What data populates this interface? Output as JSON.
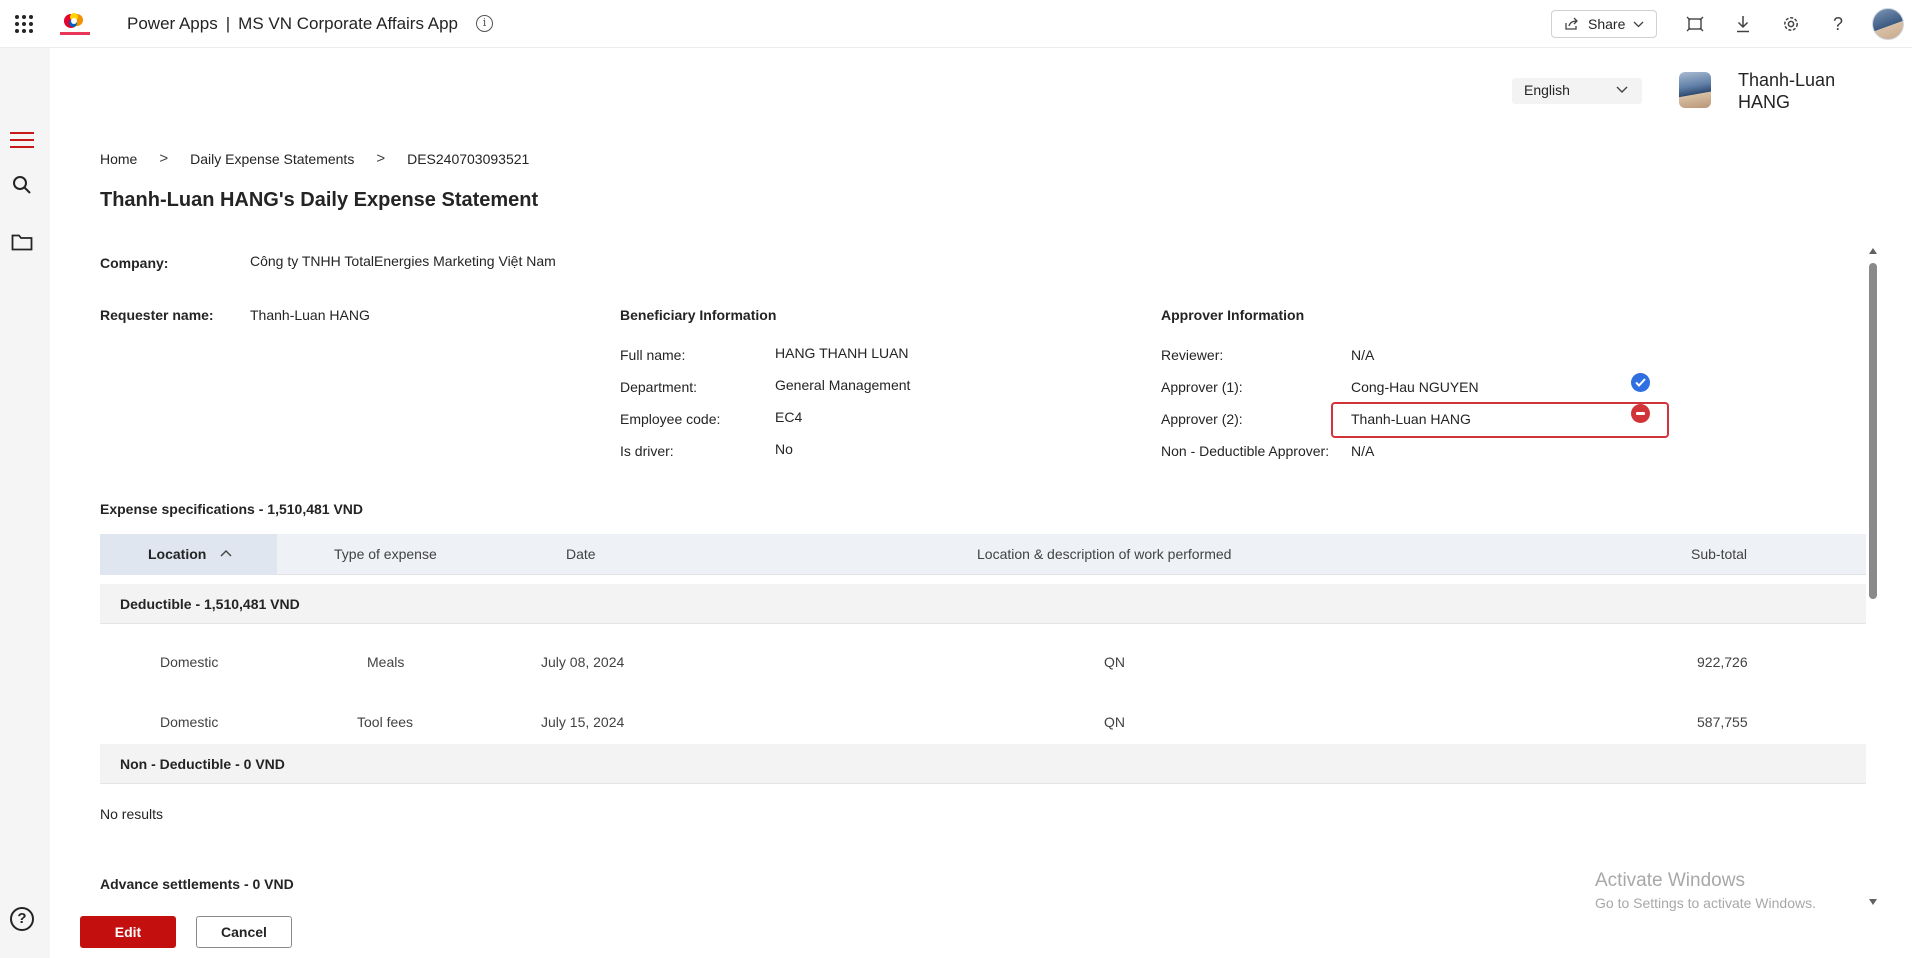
{
  "topbar": {
    "brand": "Power Apps",
    "separator": "|",
    "app_name": "MS VN Corporate Affairs App",
    "info_glyph": "i",
    "share_label": "Share",
    "icons": [
      "waffle-icon",
      "info-icon",
      "share-icon",
      "fit-screen-icon",
      "download-icon",
      "settings-icon",
      "help-icon"
    ]
  },
  "header": {
    "language": "English",
    "user_name": "Thanh-Luan HANG"
  },
  "breadcrumb": {
    "items": [
      "Home",
      "Daily Expense Statements",
      "DES240703093521"
    ],
    "separator": ">"
  },
  "page_title": "Thanh-Luan HANG's Daily Expense Statement",
  "company": {
    "label": "Company:",
    "value": "Công ty TNHH TotalEnergies Marketing Việt Nam"
  },
  "requester": {
    "label": "Requester name:",
    "value": "Thanh-Luan HANG"
  },
  "beneficiary": {
    "heading": "Beneficiary Information",
    "full_name_label": "Full name:",
    "full_name": "HANG THANH LUAN",
    "department_label": "Department:",
    "department": "General Management",
    "employee_code_label": "Employee code:",
    "employee_code": "EC4",
    "is_driver_label": "Is driver:",
    "is_driver": "No"
  },
  "approver": {
    "heading": "Approver Information",
    "reviewer_label": "Reviewer:",
    "reviewer": "N/A",
    "approver1_label": "Approver (1):",
    "approver1": "Cong-Hau NGUYEN",
    "approver1_status": "approved",
    "approver2_label": "Approver (2):",
    "approver2": "Thanh-Luan HANG",
    "approver2_status": "rejected",
    "non_deductible_label": "Non - Deductible Approver:",
    "non_deductible": "N/A",
    "colors": {
      "approved": "#2f6fe0",
      "rejected": "#d13438"
    }
  },
  "expenses": {
    "title": "Expense specifications - 1,510,481 VND",
    "columns": [
      "Location",
      "Type of expense",
      "Date",
      "Location & description of work performed",
      "Sub-total"
    ],
    "sorted_column": "Location",
    "sort_direction": "ascending",
    "groups": [
      {
        "label": "Deductible - 1,510,481 VND",
        "rows": [
          {
            "location": "Domestic",
            "type": "Meals",
            "date": "July 08, 2024",
            "description": "QN",
            "subtotal": "922,726"
          },
          {
            "location": "Domestic",
            "type": "Tool fees",
            "date": "July 15, 2024",
            "description": "QN",
            "subtotal": "587,755"
          }
        ]
      },
      {
        "label": "Non - Deductible - 0 VND",
        "rows": []
      }
    ],
    "no_results": "No results"
  },
  "advance": {
    "title": "Advance settlements - 0 VND"
  },
  "actions": {
    "edit_label": "Edit",
    "cancel_label": "Cancel",
    "edit_color": "#c40f0f"
  },
  "help_glyph": "?",
  "watermark": {
    "title": "Activate Windows",
    "subtitle": "Go to Settings to activate Windows."
  }
}
